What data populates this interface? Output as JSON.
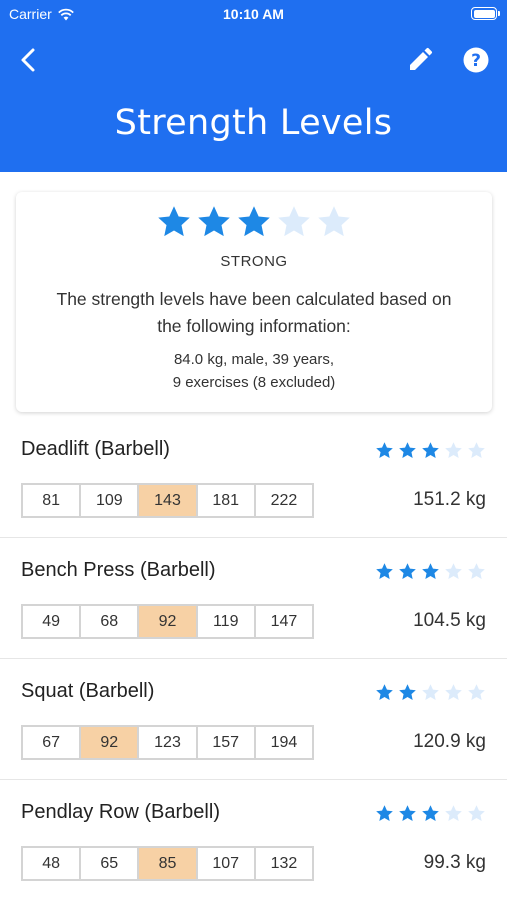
{
  "status_bar": {
    "carrier": "Carrier",
    "time": "10:10 AM"
  },
  "header": {
    "title": "Strength Levels",
    "back_icon": "chevron-left-icon",
    "edit_icon": "pencil-icon",
    "help_icon": "help-circle-icon",
    "color": "#1f6ff0"
  },
  "summary": {
    "stars_filled": 3,
    "stars_total": 5,
    "level": "STRONG",
    "description": "The strength levels have been calculated based on the following information:",
    "details_line1": "84.0 kg, male, 39 years,",
    "details_line2": "9 exercises (8 excluded)"
  },
  "colors": {
    "star_filled": "#1e88e5",
    "star_empty": "#dcebfb",
    "level_highlight": "#f7d1a5"
  },
  "exercises": [
    {
      "name": "Deadlift (Barbell)",
      "stars": 3,
      "levels": [
        "81",
        "109",
        "143",
        "181",
        "222"
      ],
      "active_index": 2,
      "weight": "151.2 kg"
    },
    {
      "name": "Bench Press (Barbell)",
      "stars": 3,
      "levels": [
        "49",
        "68",
        "92",
        "119",
        "147"
      ],
      "active_index": 2,
      "weight": "104.5 kg"
    },
    {
      "name": "Squat (Barbell)",
      "stars": 2,
      "levels": [
        "67",
        "92",
        "123",
        "157",
        "194"
      ],
      "active_index": 1,
      "weight": "120.9 kg"
    },
    {
      "name": "Pendlay Row (Barbell)",
      "stars": 3,
      "levels": [
        "48",
        "65",
        "85",
        "107",
        "132"
      ],
      "active_index": 2,
      "weight": "99.3 kg"
    }
  ]
}
